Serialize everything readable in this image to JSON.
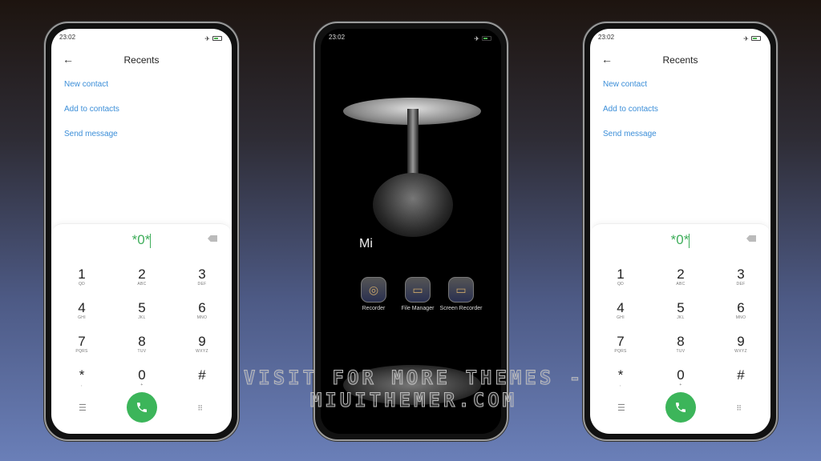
{
  "status": {
    "time": "23:02"
  },
  "dialer": {
    "title": "Recents",
    "back_icon": "arrow-left-icon",
    "actions": [
      "New contact",
      "Add to contacts",
      "Send message"
    ],
    "input": "*0*",
    "keys": [
      {
        "n": "1",
        "l": "QD"
      },
      {
        "n": "2",
        "l": "ABC"
      },
      {
        "n": "3",
        "l": "DEF"
      },
      {
        "n": "4",
        "l": "GHI"
      },
      {
        "n": "5",
        "l": "JKL"
      },
      {
        "n": "6",
        "l": "MNO"
      },
      {
        "n": "7",
        "l": "PQRS"
      },
      {
        "n": "8",
        "l": "TUV"
      },
      {
        "n": "9",
        "l": "WXYZ"
      },
      {
        "n": "*",
        "l": ","
      },
      {
        "n": "0",
        "l": "+"
      },
      {
        "n": "#",
        "l": ""
      }
    ],
    "accent": "#3cb55a",
    "link_color": "#3b8ed8"
  },
  "home": {
    "folder": "Mi",
    "apps": [
      {
        "label": "Recorder",
        "icon": "recorder-icon"
      },
      {
        "label": "File Manager",
        "icon": "folder-icon"
      },
      {
        "label": "Screen Recorder",
        "icon": "video-camera-icon"
      }
    ]
  },
  "watermark": "VISIT FOR MORE THEMES - MIUITHEMER.COM"
}
